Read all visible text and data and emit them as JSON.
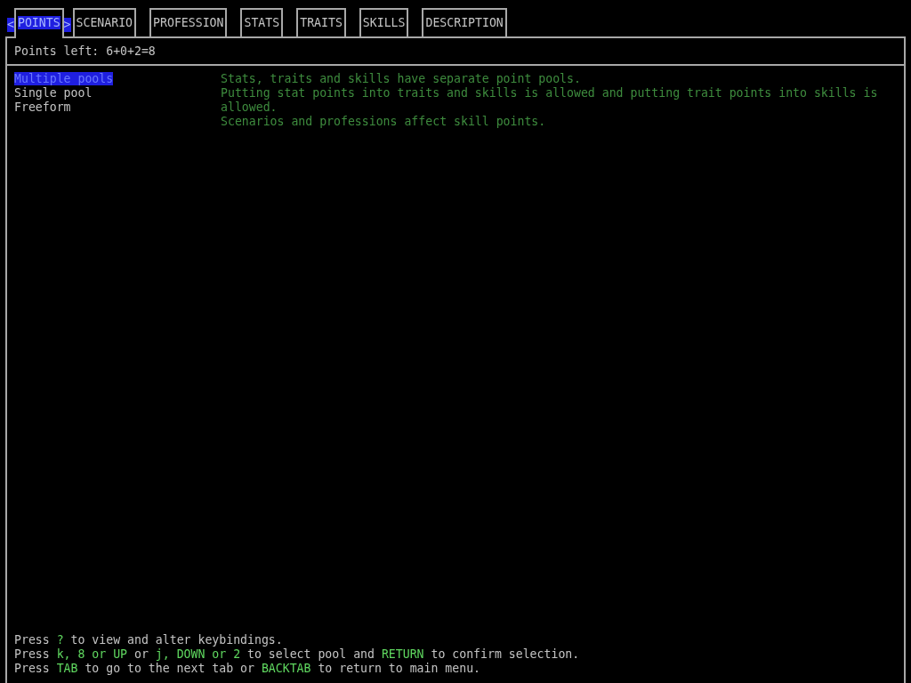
{
  "tabs": {
    "prev_arrow": "<",
    "next_arrow": ">",
    "items": [
      {
        "label": "POINTS",
        "selected": true
      },
      {
        "label": "SCENARIO",
        "selected": false
      },
      {
        "label": "PROFESSION",
        "selected": false
      },
      {
        "label": "STATS",
        "selected": false
      },
      {
        "label": "TRAITS",
        "selected": false
      },
      {
        "label": "SKILLS",
        "selected": false
      },
      {
        "label": "DESCRIPTION",
        "selected": false
      }
    ]
  },
  "points_left": "Points left: 6+0+2=8",
  "pools": [
    {
      "label": "Multiple pools",
      "selected": true
    },
    {
      "label": "Single pool",
      "selected": false
    },
    {
      "label": "Freeform",
      "selected": false
    }
  ],
  "description": [
    "Stats, traits and skills have separate point pools.",
    "Putting stat points into traits and skills is allowed and putting trait points into skills is allowed.",
    "Scenarios and professions affect skill points."
  ],
  "help": [
    [
      {
        "kind": "plain",
        "text": "Press "
      },
      {
        "kind": "key",
        "text": "?"
      },
      {
        "kind": "plain",
        "text": " to view and alter keybindings."
      }
    ],
    [
      {
        "kind": "plain",
        "text": "Press "
      },
      {
        "kind": "key",
        "text": "k, 8 or UP"
      },
      {
        "kind": "plain",
        "text": " or "
      },
      {
        "kind": "key",
        "text": "j, DOWN or 2"
      },
      {
        "kind": "plain",
        "text": " to select pool and "
      },
      {
        "kind": "key",
        "text": "RETURN"
      },
      {
        "kind": "plain",
        "text": " to confirm selection."
      }
    ],
    [
      {
        "kind": "plain",
        "text": "Press "
      },
      {
        "kind": "key",
        "text": "TAB"
      },
      {
        "kind": "plain",
        "text": " to go to the next tab or "
      },
      {
        "kind": "key",
        "text": "BACKTAB"
      },
      {
        "kind": "plain",
        "text": " to return to main menu."
      }
    ]
  ]
}
